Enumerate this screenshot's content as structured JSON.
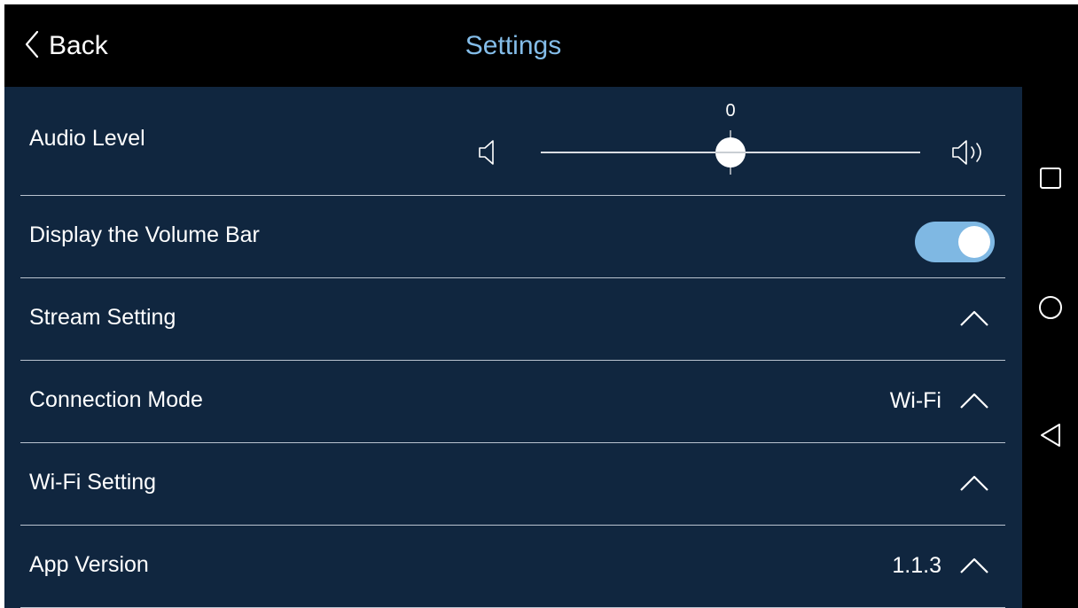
{
  "header": {
    "back_label": "Back",
    "title": "Settings"
  },
  "settings": {
    "audio_level": {
      "label": "Audio Level",
      "value": "0",
      "slider_fraction": 0.5
    },
    "volume_bar": {
      "label": "Display the Volume Bar",
      "enabled": true
    },
    "stream": {
      "label": "Stream Setting"
    },
    "connection": {
      "label": "Connection Mode",
      "value": "Wi-Fi"
    },
    "wifi": {
      "label": "Wi-Fi Setting"
    },
    "version": {
      "label": "App Version",
      "value": "1.1.3"
    }
  },
  "icons": {
    "back": "chevron-left-icon",
    "volume_low": "speaker-low-icon",
    "volume_high": "speaker-high-icon",
    "expand": "chevron-up-icon",
    "nav_recents": "square-icon",
    "nav_home": "circle-icon",
    "nav_back": "triangle-back-icon"
  },
  "colors": {
    "panel": "#10263f",
    "title": "#84bde9",
    "toggle_on": "#7fb8e3"
  }
}
